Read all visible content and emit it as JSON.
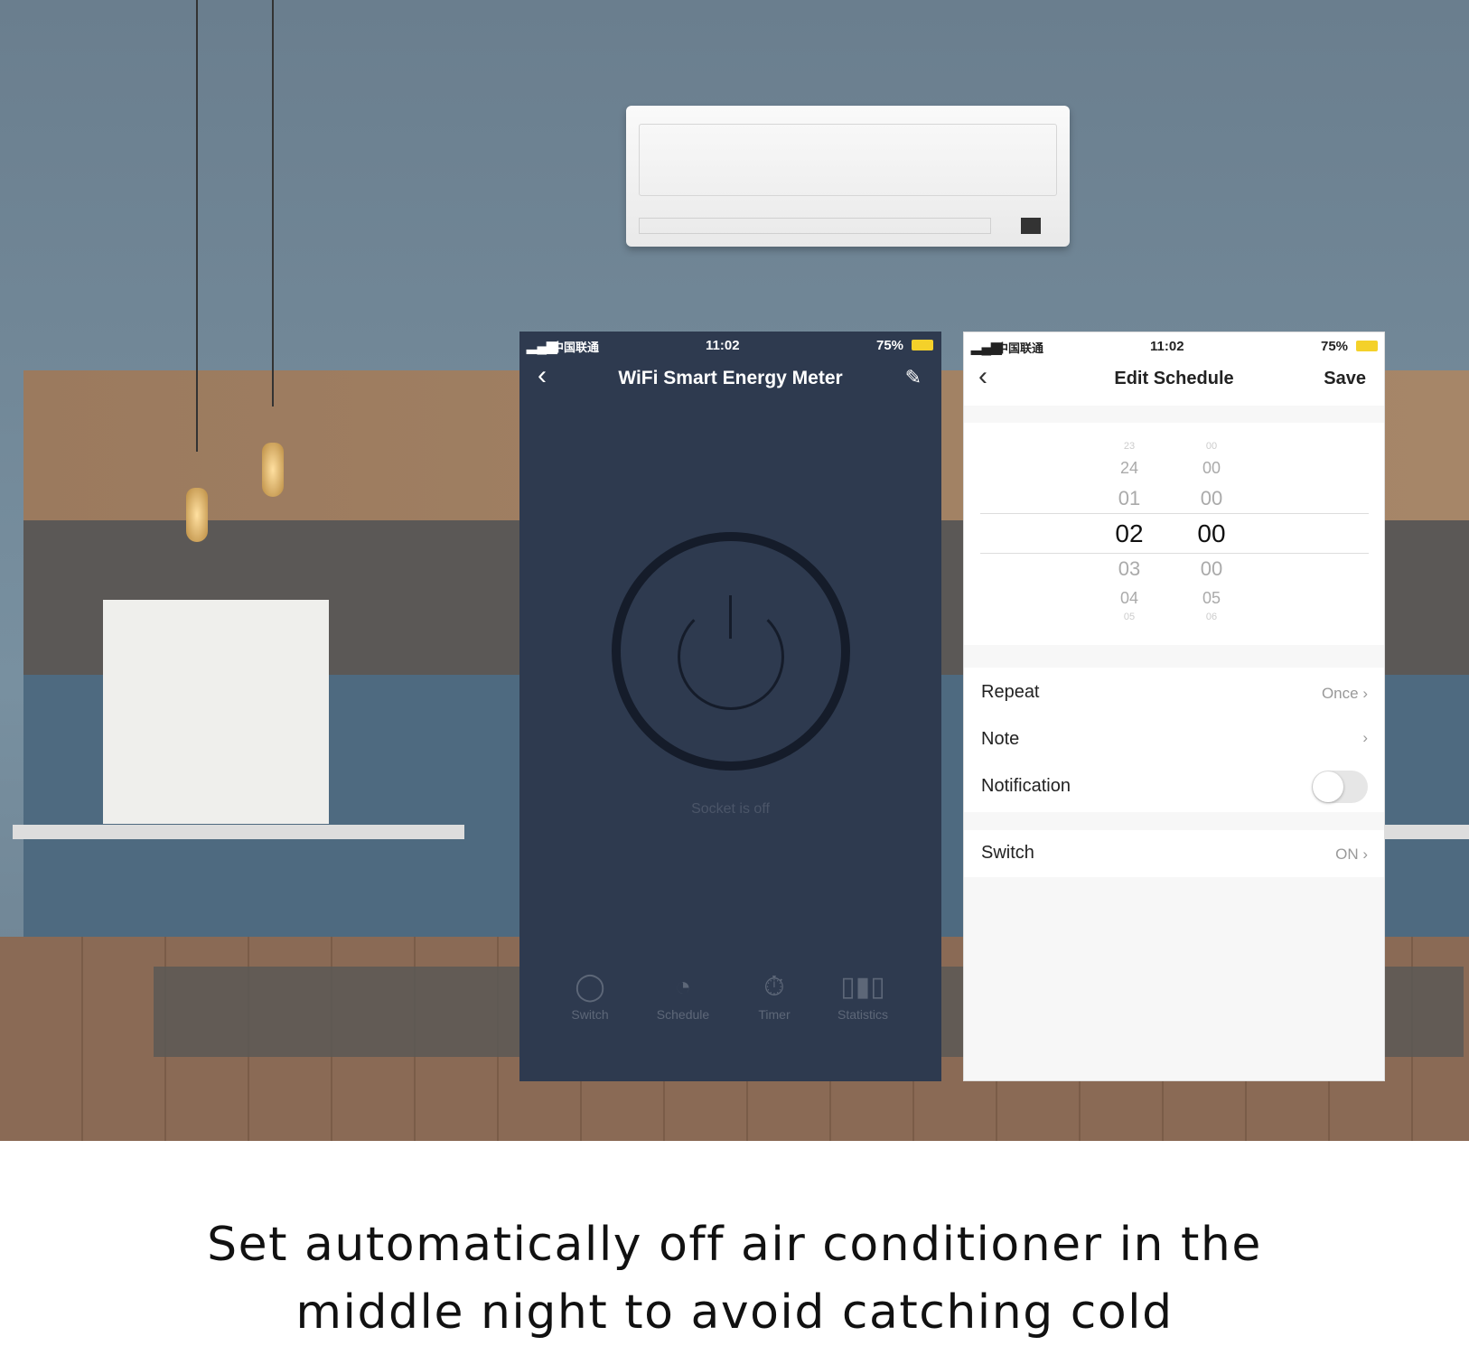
{
  "caption": {
    "line1": "Set automatically off air conditioner in the",
    "line2": "middle night to avoid catching cold"
  },
  "status_bar": {
    "carrier": "中国联通",
    "time": "11:02",
    "battery": "75%"
  },
  "meter_screen": {
    "title": "WiFi Smart Energy Meter",
    "state_text": "Socket is off",
    "tabs": [
      {
        "label": "Switch",
        "icon": "switch-icon"
      },
      {
        "label": "Schedule",
        "icon": "clock-icon"
      },
      {
        "label": "Timer",
        "icon": "stopwatch-icon"
      },
      {
        "label": "Statistics",
        "icon": "bar-chart-icon"
      }
    ],
    "bg_color": "#2e3a4f"
  },
  "schedule_screen": {
    "title": "Edit Schedule",
    "save_label": "Save",
    "picker": {
      "hours": [
        "23",
        "24",
        "01",
        "02",
        "03",
        "04",
        "05"
      ],
      "minutes": [
        "00",
        "00",
        "00",
        "00",
        "00",
        "05",
        "06"
      ],
      "selected_hour": "02",
      "selected_minute": "00"
    },
    "rows": {
      "repeat": {
        "label": "Repeat",
        "value": "Once"
      },
      "note": {
        "label": "Note"
      },
      "notification": {
        "label": "Notification",
        "enabled": false
      },
      "switch": {
        "label": "Switch",
        "value": "ON"
      }
    }
  }
}
